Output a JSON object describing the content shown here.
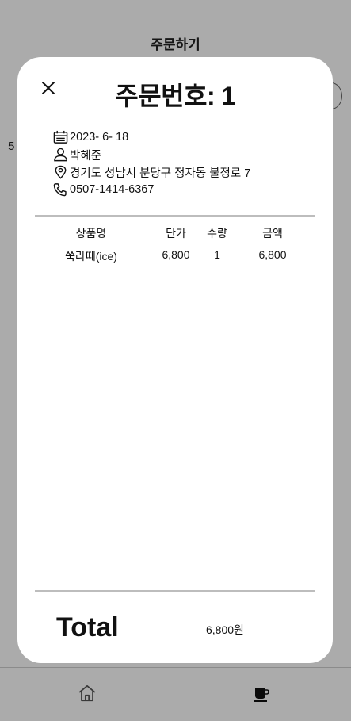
{
  "app": {
    "title": "주문하기",
    "peek_number": "5"
  },
  "modal": {
    "title": "주문번호: 1",
    "date": "2023- 6- 18",
    "customer": "박혜준",
    "address": "경기도 성남시 분당구 정자동 불정로 7",
    "phone": "0507-1414-6367"
  },
  "table": {
    "headers": [
      "상품명",
      "단가",
      "수량",
      "금액"
    ],
    "rows": [
      {
        "name": "쑥라떼(ice)",
        "price": "6,800",
        "qty": "1",
        "amount": "6,800"
      }
    ]
  },
  "total": {
    "label": "Total",
    "value": "6,800원"
  },
  "tabbar": {
    "items": [
      {
        "icon": "home-icon"
      },
      {
        "icon": "coffee-cup-icon"
      }
    ]
  }
}
